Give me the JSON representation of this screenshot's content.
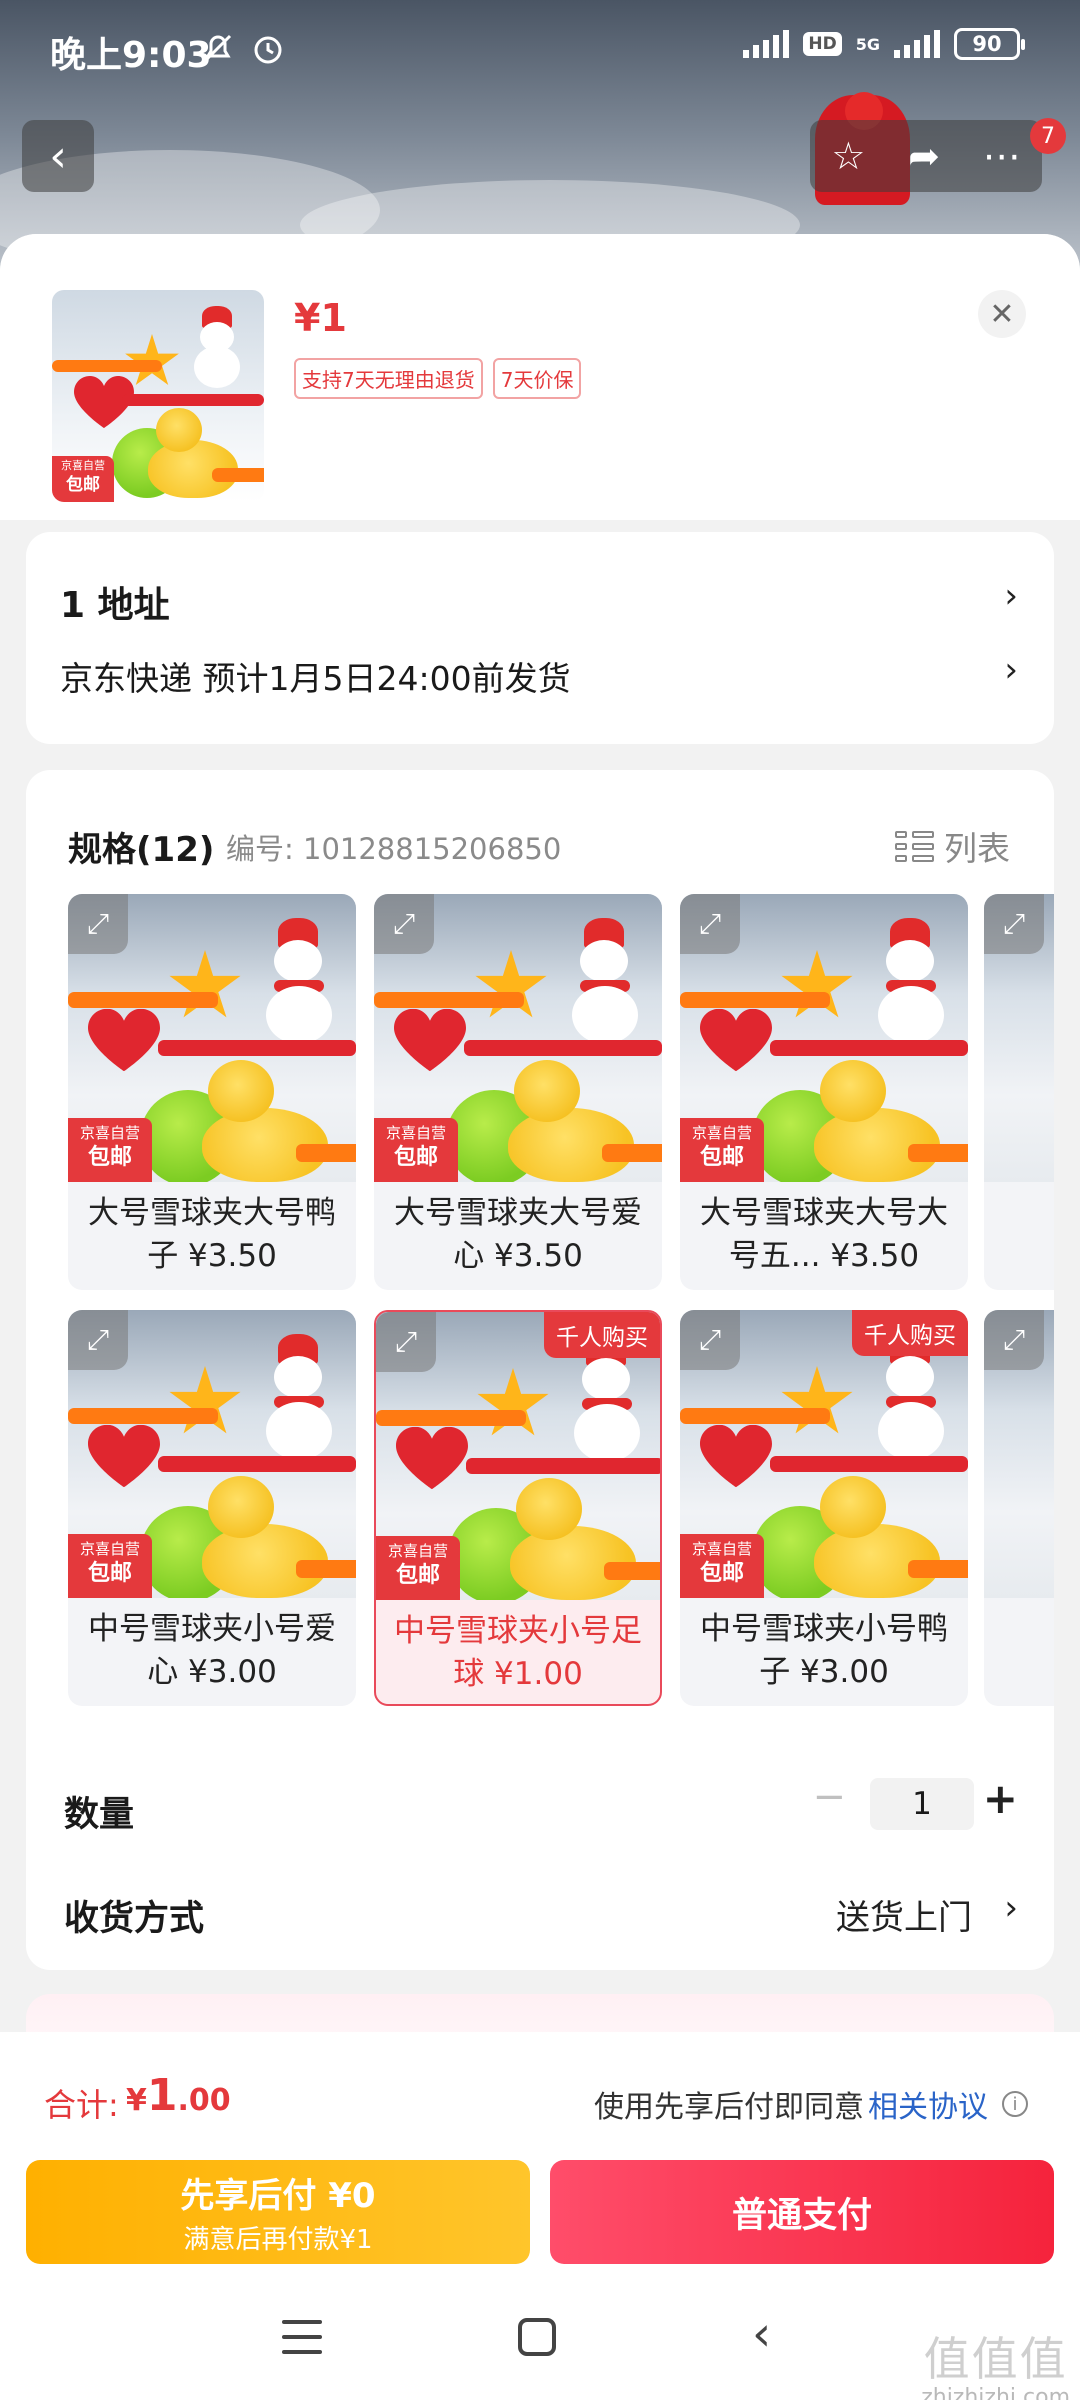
{
  "status_bar": {
    "time": "晚上9:03",
    "network": "5G",
    "hd": "HD",
    "battery": "90"
  },
  "header": {
    "notification_count": "7",
    "icons": [
      "back-icon",
      "star-icon",
      "share-icon",
      "more-icon"
    ]
  },
  "product": {
    "price": "¥1",
    "tags": [
      "支持7天无理由退货",
      "7天价保"
    ],
    "thumb_badge_top": "京喜自营",
    "thumb_badge_bottom": "包邮"
  },
  "address": {
    "line1": "1  地址",
    "line2": "京东快递 预计1月5日24:00前发货"
  },
  "spec": {
    "title": "规格(12)",
    "code": "编号: 10128815206850",
    "list_label": "列表",
    "items": [
      {
        "name": "大号雪球夹大号鸭子 ¥3.50",
        "badge_top": "京喜自营",
        "badge_bottom": "包邮"
      },
      {
        "name": "大号雪球夹大号爱心 ¥3.50",
        "badge_top": "京喜自营",
        "badge_bottom": "包邮"
      },
      {
        "name": "大号雪球夹大号大号五... ¥3.50",
        "badge_top": "京喜自营",
        "badge_bottom": "包邮"
      },
      {
        "name": "中号雪球夹小号爱心 ¥3.00",
        "badge_top": "京喜自营",
        "badge_bottom": "包邮"
      },
      {
        "name": "中号雪球夹小号足球 ¥1.00",
        "badge_top": "京喜自营",
        "badge_bottom": "包邮",
        "hot": "千人购买",
        "selected": true
      },
      {
        "name": "中号雪球夹小号鸭子 ¥3.00",
        "badge_top": "京喜自营",
        "badge_bottom": "包邮",
        "hot": "千人购买"
      }
    ]
  },
  "quantity": {
    "label": "数量",
    "value": "1",
    "minus": "−",
    "plus": "+"
  },
  "delivery": {
    "label": "收货方式",
    "value": "送货上门"
  },
  "footer": {
    "total_label": "合计:",
    "total_symbol": "¥",
    "total_int": "1",
    "total_dec": ".00",
    "agree_text": "使用先享后付即同意",
    "agree_link": "相关协议",
    "pay_later_line1": "先享后付 ¥0",
    "pay_later_line2": "满意后再付款¥1",
    "pay_normal": "普通支付"
  },
  "watermark": {
    "big": "值值值",
    "small": "zhizhizhi.com"
  },
  "colors": {
    "accent_red": "#e4393c",
    "pay_later": "#ffb000",
    "pay_normal": "#f5233c",
    "link": "#2a64c8"
  }
}
